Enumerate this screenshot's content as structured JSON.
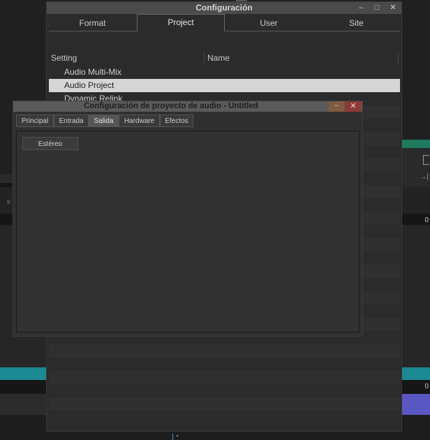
{
  "config_window": {
    "title": "Configuración",
    "min_glyph": "–",
    "max_glyph": "□",
    "close_glyph": "✕",
    "tabs": [
      {
        "label": "Format",
        "active": false
      },
      {
        "label": "Project",
        "active": true
      },
      {
        "label": "User",
        "active": false
      },
      {
        "label": "Site",
        "active": false
      }
    ],
    "columns": {
      "setting": "Setting",
      "name": "Name"
    },
    "rows": [
      "Audio Multi-Mix",
      "Audio Project",
      "Dynamic Relink"
    ],
    "selected_row": "Audio Project"
  },
  "audio_dialog": {
    "title": "Configuración de proyecto de audio - Untitled",
    "min_glyph": "–",
    "close_glyph": "✕",
    "tabs": [
      {
        "label": "Principal",
        "active": false
      },
      {
        "label": "Entrada",
        "active": false
      },
      {
        "label": "Salida",
        "active": true
      },
      {
        "label": "Hardware",
        "active": false
      },
      {
        "label": "Efectos",
        "active": false
      }
    ],
    "output_button": "Estéreo"
  },
  "background": {
    "zero_label_1": "0",
    "zero_label_2": "0",
    "side_glyph": "→|",
    "small_label": "ɐ"
  },
  "colors": {
    "teal_track": "#1c8a92",
    "purple_clip": "#5a56c2",
    "selection": "#d6d6d6",
    "close_red": "#8e3a3a"
  }
}
